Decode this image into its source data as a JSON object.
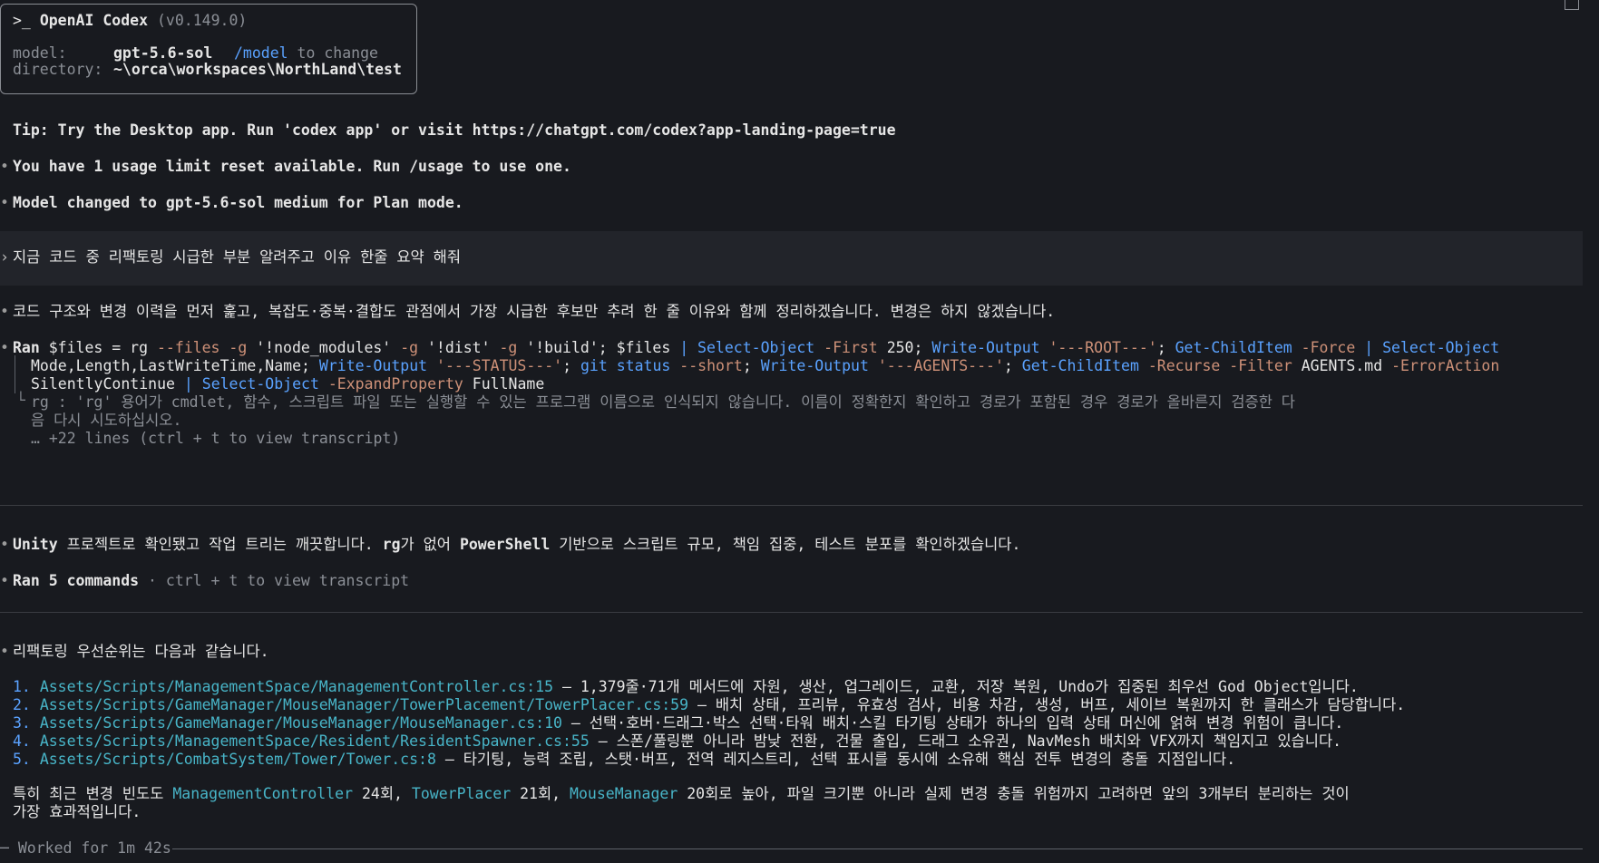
{
  "header": {
    "prompt": ">_",
    "app_name": "OpenAI Codex",
    "version": "(v0.149.0)",
    "model_label": "model:",
    "model_value": "gpt-5.6-sol",
    "model_hint_cmd": "/model",
    "model_hint_text": " to change",
    "dir_label": "directory:",
    "dir_value": "~\\orca\\workspaces\\NorthLand\\test"
  },
  "tip": "Tip: Try the Desktop app. Run 'codex app' or visit https://chatgpt.com/codex?app-landing-page=true",
  "notices": [
    "You have 1 usage limit reset available. Run /usage to use one.",
    "Model changed to gpt-5.6-sol medium for Plan mode."
  ],
  "user_message": "지금 코드 중 리팩토링 시급한 부분 알려주고 이유 한줄 요약 해줘",
  "assistant_intro": "코드 구조와 변경 이력을 먼저 훑고, 복잡도·중복·결합도 관점에서 가장 시급한 후보만 추려 한 줄 이유와 함께 정리하겠습니다. 변경은 하지 않겠습니다.",
  "ran1": {
    "prefix": "Ran",
    "line1": [
      {
        "t": " $files = rg ",
        "c": ""
      },
      {
        "t": "--files -g ",
        "c": "str"
      },
      {
        "t": "'!node_modules' ",
        "c": ""
      },
      {
        "t": "-g ",
        "c": "str"
      },
      {
        "t": "'!dist' ",
        "c": ""
      },
      {
        "t": "-g ",
        "c": "str"
      },
      {
        "t": "'!build'",
        "c": ""
      },
      {
        "t": "; $files ",
        "c": ""
      },
      {
        "t": "| Select-Object ",
        "c": "kw"
      },
      {
        "t": "-First ",
        "c": "str"
      },
      {
        "t": "250; ",
        "c": ""
      },
      {
        "t": "Write-Output ",
        "c": "kw"
      },
      {
        "t": "'---ROOT---'",
        "c": "str"
      },
      {
        "t": "; ",
        "c": ""
      },
      {
        "t": "Get-ChildItem ",
        "c": "kw"
      },
      {
        "t": "-Force ",
        "c": "str"
      },
      {
        "t": "| Select-Object",
        "c": "kw"
      }
    ],
    "line2": [
      {
        "t": "Mode,Length,LastWriteTime,Name; ",
        "c": ""
      },
      {
        "t": "Write-Output ",
        "c": "kw"
      },
      {
        "t": "'---STATUS---'",
        "c": "str"
      },
      {
        "t": "; ",
        "c": ""
      },
      {
        "t": "git status ",
        "c": "kw"
      },
      {
        "t": "--short",
        "c": "str"
      },
      {
        "t": "; ",
        "c": ""
      },
      {
        "t": "Write-Output ",
        "c": "kw"
      },
      {
        "t": "'---AGENTS---'",
        "c": "str"
      },
      {
        "t": "; ",
        "c": ""
      },
      {
        "t": "Get-ChildItem ",
        "c": "kw"
      },
      {
        "t": "-Recurse -Filter ",
        "c": "str"
      },
      {
        "t": "AGENTS.md ",
        "c": ""
      },
      {
        "t": "-ErrorAction",
        "c": "str"
      }
    ],
    "line3": [
      {
        "t": "SilentlyContinue ",
        "c": ""
      },
      {
        "t": "| Select-Object ",
        "c": "kw"
      },
      {
        "t": "-ExpandProperty ",
        "c": "str"
      },
      {
        "t": "FullName",
        "c": ""
      }
    ],
    "out1": "rg : 'rg' 용어가 cmdlet, 함수, 스크립트 파일 또는 실행할 수 있는 프로그램 이름으로 인식되지 않습니다. 이름이 정확한지 확인하고 경로가 포함된 경우 경로가 올바른지 검증한 다",
    "out2": "음 다시 시도하십시오.",
    "out3": "… +22 lines (ctrl + t to view transcript)"
  },
  "assistant_2": {
    "p1": "Unity",
    "p2": " 프로젝트로 확인됐고 작업 트리는 깨끗합니다. ",
    "p3": "rg",
    "p4": "가 없어 ",
    "p5": "PowerShell",
    "p6": " 기반으로 스크립트 규모, 책임 집중, 테스트 분포를 확인하겠습니다."
  },
  "ran2": {
    "label": "Ran 5 commands",
    "hint": " · ctrl + t to view transcript"
  },
  "priority_title": "리팩토링 우선순위는 다음과 같습니다.",
  "priorities": [
    {
      "num": "1.",
      "path": "Assets/Scripts/ManagementSpace/ManagementController.cs:15",
      "desc": " – 1,379줄·71개 메서드에 자원, 생산, 업그레이드, 교환, 저장 복원, Undo가 집중된 최우선 God Object입니다."
    },
    {
      "num": "2.",
      "path": "Assets/Scripts/GameManager/MouseManager/TowerPlacement/TowerPlacer.cs:59",
      "desc": " – 배치 상태, 프리뷰, 유효성 검사, 비용 차감, 생성, 버프, 세이브 복원까지 한 클래스가 담당합니다."
    },
    {
      "num": "3.",
      "path": "Assets/Scripts/GameManager/MouseManager/MouseManager.cs:10",
      "desc": " – 선택·호버·드래그·박스 선택·타워 배치·스킬 타기팅 상태가 하나의 입력 상태 머신에 얽혀 변경 위험이 큽니다."
    },
    {
      "num": "4.",
      "path": "Assets/Scripts/ManagementSpace/Resident/ResidentSpawner.cs:55",
      "desc": " – 스폰/풀링뿐 아니라 밤낮 전환, 건물 출입, 드래그 소유권, NavMesh 배치와 VFX까지 책임지고 있습니다."
    },
    {
      "num": "5.",
      "path": "Assets/Scripts/CombatSystem/Tower/Tower.cs:8",
      "desc": " – 타기팅, 능력 조립, 스탯·버프, 전역 레지스트리, 선택 표시를 동시에 소유해 핵심 전투 변경의 충돌 지점입니다."
    }
  ],
  "summary": {
    "a": "특히 최근 변경 빈도도 ",
    "b": "ManagementController",
    "c": " 24회, ",
    "d": "TowerPlacer",
    "e": " 21회, ",
    "f": "MouseManager",
    "g": " 20회로 높아, 파일 크기뿐 아니라 실제 변경 충돌 위험까지 고려하면 앞의 3개부터 분리하는 것이",
    "line2": "가장 효과적입니다."
  },
  "worked": "Worked for 1m 42s"
}
